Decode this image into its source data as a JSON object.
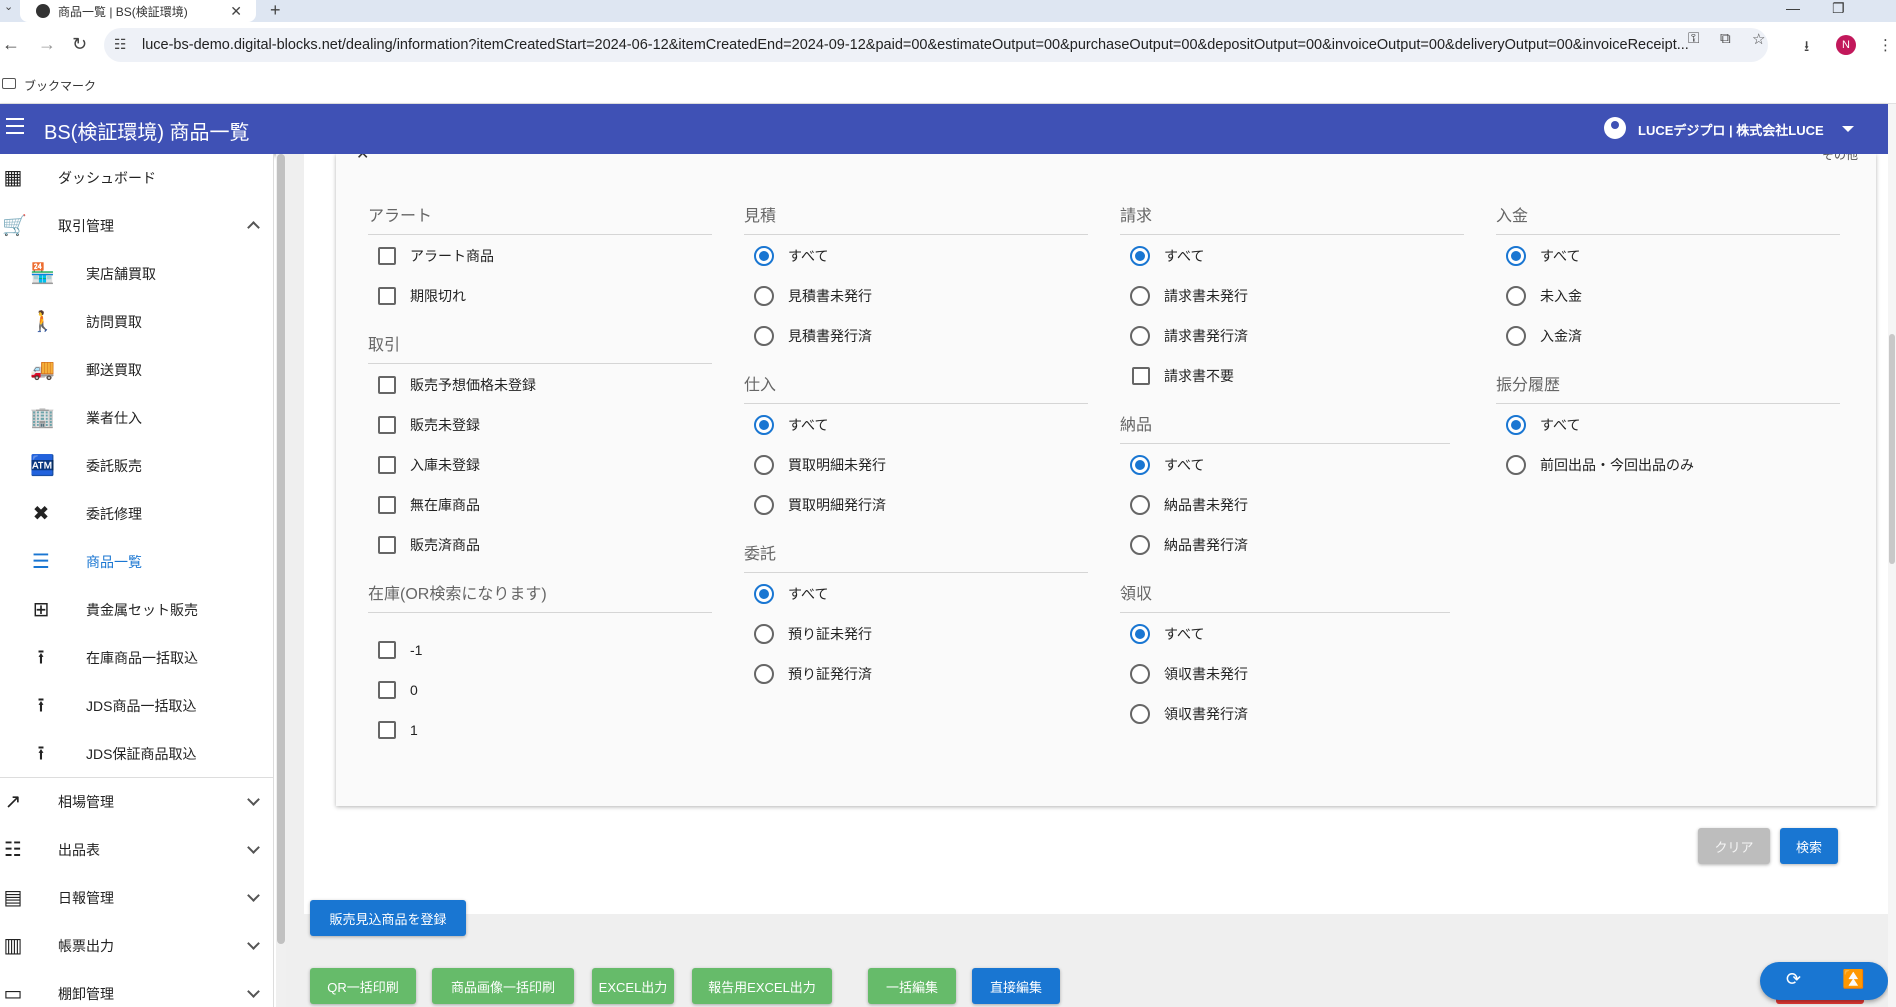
{
  "browser": {
    "tab_title": "商品一覧 | BS(検証環境)",
    "close": "✕",
    "new_tab": "+",
    "url": "luce-bs-demo.digital-blocks.net/dealing/information?itemCreatedStart=2024-06-12&itemCreatedEnd=2024-09-12&paid=00&estimateOutput=00&purchaseOutput=00&depositOutput=00&invoiceOutput=00&deliveryOutput=00&invoiceReceipt...",
    "bookmarks_label": "ブックマーク",
    "profile_initial": "N",
    "back": "←",
    "forward": "→",
    "reload": "↻"
  },
  "appbar": {
    "title": "BS(検証環境) 商品一覧",
    "account": "LUCEデジプロ | 株式会社LUCE"
  },
  "sidebar": {
    "items": [
      {
        "label": "ダッシュボード",
        "icon": "dashboard-icon",
        "glyph": "▦"
      },
      {
        "label": "取引管理",
        "icon": "cart-icon",
        "glyph": "🛒"
      },
      {
        "label": "実店舗買取",
        "icon": "store-icon",
        "glyph": "🏪"
      },
      {
        "label": "訪問買取",
        "icon": "walk-icon",
        "glyph": "🚶"
      },
      {
        "label": "郵送買取",
        "icon": "truck-icon",
        "glyph": "🚚"
      },
      {
        "label": "業者仕入",
        "icon": "building-icon",
        "glyph": "🏢"
      },
      {
        "label": "委託販売",
        "icon": "register-icon",
        "glyph": "🏧"
      },
      {
        "label": "委託修理",
        "icon": "tools-icon",
        "glyph": "✖"
      },
      {
        "label": "商品一覧",
        "icon": "list-icon",
        "glyph": "☰"
      },
      {
        "label": "貴金属セット販売",
        "icon": "grid-icon",
        "glyph": "⊞"
      },
      {
        "label": "在庫商品一括取込",
        "icon": "upload-icon",
        "glyph": "⭱"
      },
      {
        "label": "JDS商品一括取込",
        "icon": "upload-icon",
        "glyph": "⭱"
      },
      {
        "label": "JDS保証商品取込",
        "icon": "upload-icon",
        "glyph": "⭱"
      },
      {
        "label": "相場管理",
        "icon": "trending-icon",
        "glyph": "↗"
      },
      {
        "label": "出品表",
        "icon": "list-alt-icon",
        "glyph": "☷"
      },
      {
        "label": "日報管理",
        "icon": "document-icon",
        "glyph": "▤"
      },
      {
        "label": "帳票出力",
        "icon": "receipt-icon",
        "glyph": "▥"
      },
      {
        "label": "棚卸管理",
        "icon": "inventory-icon",
        "glyph": "▭"
      }
    ]
  },
  "filters": {
    "sonota": "その他",
    "alert": {
      "title": "アラート",
      "options": [
        "アラート商品",
        "期限切れ"
      ]
    },
    "torihiki": {
      "title": "取引",
      "options": [
        "販売予想価格未登録",
        "販売未登録",
        "入庫未登録",
        "無在庫商品",
        "販売済商品"
      ]
    },
    "zaiko": {
      "title": "在庫(OR検索になります)",
      "options": [
        "-1",
        "0",
        "1"
      ]
    },
    "mitsumori": {
      "title": "見積",
      "options": [
        "すべて",
        "見積書未発行",
        "見積書発行済"
      ],
      "selected": 0
    },
    "shiire": {
      "title": "仕入",
      "options": [
        "すべて",
        "買取明細未発行",
        "買取明細発行済"
      ],
      "selected": 0
    },
    "itaku": {
      "title": "委託",
      "options": [
        "すべて",
        "預り証未発行",
        "預り証発行済"
      ],
      "selected": 0
    },
    "seikyu": {
      "title": "請求",
      "options": [
        "すべて",
        "請求書未発行",
        "請求書発行済"
      ],
      "selected": 0,
      "checkbox": "請求書不要"
    },
    "nohin": {
      "title": "納品",
      "options": [
        "すべて",
        "納品書未発行",
        "納品書発行済"
      ],
      "selected": 0
    },
    "ryoshu": {
      "title": "領収",
      "options": [
        "すべて",
        "領収書未発行",
        "領収書発行済"
      ],
      "selected": 0
    },
    "nyukin": {
      "title": "入金",
      "options": [
        "すべて",
        "未入金",
        "入金済"
      ],
      "selected": 0
    },
    "furiwake": {
      "title": "振分履歴",
      "options": [
        "すべて",
        "前回出品・今回出品のみ"
      ],
      "selected": 0
    }
  },
  "actions": {
    "clear": "クリア",
    "search": "検索",
    "register": "販売見込商品を登録",
    "bottom": [
      "QR一括印刷",
      "商品画像一括印刷",
      "EXCEL出力",
      "報告用EXCEL出力",
      "一括編集",
      "直接編集"
    ]
  }
}
